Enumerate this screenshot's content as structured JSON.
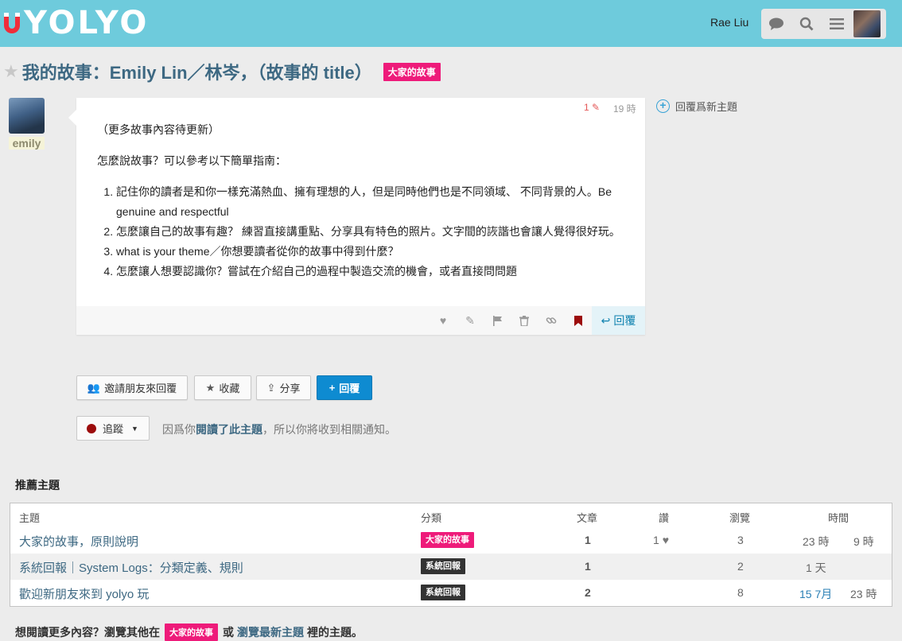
{
  "header": {
    "logo_text": "YOLYO",
    "user_name": "Rae Liu",
    "icons": [
      "chat-icon",
      "search-icon",
      "menu-icon",
      "avatar"
    ]
  },
  "topic": {
    "title": "我的故事：Emily Lin／林岑，（故事的 title）",
    "category": "大家的故事",
    "category_color": "#ee1b7a"
  },
  "post": {
    "username": "emily",
    "edit_count": "1",
    "time": "19 時",
    "intro": "（更多故事內容待更新）",
    "lead": "怎麼說故事？可以參考以下簡單指南：",
    "items": [
      "記住你的讀者是和你一樣充滿熱血、擁有理想的人，但是同時他們也是不同領域、 不同背景的人。Be genuine and respectful",
      "怎麼讓自己的故事有趣？ 練習直接講重點、分享具有特色的照片。文字間的詼諧也會讓人覺得很好玩。",
      "what is your theme／你想要讀者從你的故事中得到什麼？",
      "怎麼讓人想要認識你？嘗試在介紹自己的過程中製造交流的機會，或者直接問問題"
    ],
    "reply_label": "回覆",
    "reply_new_topic": "回覆爲新主題"
  },
  "buttons": {
    "invite": "邀請朋友來回覆",
    "bookmark": "收藏",
    "share": "分享",
    "reply": "回覆"
  },
  "tracking": {
    "label": "追蹤",
    "note_pre": "因爲你",
    "note_link": "閱讀了此主題",
    "note_post": "，所以你將收到相關通知。"
  },
  "suggested": {
    "title": "推薦主題",
    "columns": [
      "主題",
      "分類",
      "文章",
      "讚",
      "瀏覽",
      "時間"
    ],
    "rows": [
      {
        "topic": "大家的故事，原則說明",
        "category": "大家的故事",
        "category_style": "pink",
        "posts": "1",
        "likes": "1",
        "views": "3",
        "time1": "23 時",
        "time2": "9 時"
      },
      {
        "topic": "系統回報｜System Logs：分類定義、規則",
        "category": "系統回報",
        "category_style": "dark",
        "posts": "1",
        "likes": "",
        "views": "2",
        "time1": "1 天",
        "time2": ""
      },
      {
        "topic": "歡迎新朋友來到 yolyo 玩",
        "category": "系統回報",
        "category_style": "dark",
        "posts": "2",
        "likes": "",
        "views": "8",
        "time1": "15 7月",
        "time2": "23 時"
      }
    ]
  },
  "footer": {
    "pre": "想閱讀更多內容？瀏覽其他在",
    "category": "大家的故事",
    "mid": "或",
    "link": "瀏覽最新主題",
    "post": "裡的主題。"
  }
}
